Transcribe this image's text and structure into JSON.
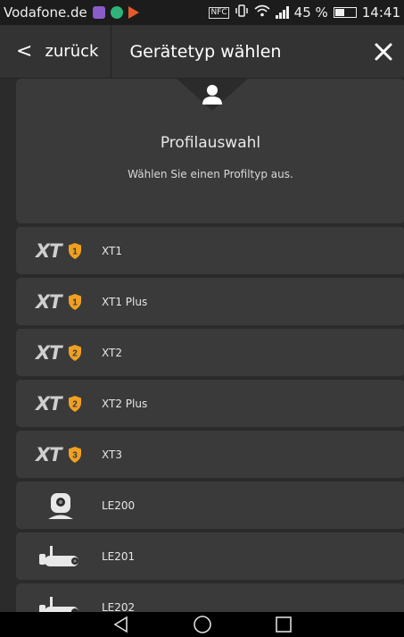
{
  "status_bar": {
    "carrier": "Vodafone.de",
    "nfc_label": "NFC",
    "battery": "45 %",
    "battery_level": 0.45,
    "time": "14:41",
    "icons": [
      "gallery-icon",
      "chat-icon",
      "play-store-icon",
      "nfc-icon",
      "vibrate-icon",
      "wifi-icon",
      "signal-icon",
      "battery-icon"
    ]
  },
  "header": {
    "back_label": "zurück",
    "title": "Gerätetyp wählen",
    "close_icon": "close-icon"
  },
  "profile": {
    "title": "Profilauswahl",
    "subtitle": "Wählen Sie einen Profiltyp aus.",
    "icon": "person-icon"
  },
  "devices": [
    {
      "logo_text": "XT",
      "badge": "1",
      "label": "XT1",
      "icon": "xt-shield-1-icon"
    },
    {
      "logo_text": "XT",
      "badge": "1",
      "label": "XT1 Plus",
      "icon": "xt-shield-1-icon"
    },
    {
      "logo_text": "XT",
      "badge": "2",
      "label": "XT2",
      "icon": "xt-shield-2-icon"
    },
    {
      "logo_text": "XT",
      "badge": "2",
      "label": "XT2 Plus",
      "icon": "xt-shield-2-icon"
    },
    {
      "logo_text": "XT",
      "badge": "3",
      "label": "XT3",
      "icon": "xt-shield-3-icon"
    },
    {
      "label": "LE200",
      "icon": "indoor-camera-icon"
    },
    {
      "label": "LE201",
      "icon": "outdoor-camera-icon"
    },
    {
      "label": "LE202",
      "icon": "outdoor-camera-icon"
    }
  ],
  "navbar": {
    "icons": [
      "back-triangle-icon",
      "home-circle-icon",
      "recents-square-icon"
    ]
  },
  "colors": {
    "background": "#2b2b2b",
    "card": "#3a3a3a",
    "header": "#333333",
    "shield_orange": "#f0a021",
    "text": "#ffffff"
  }
}
